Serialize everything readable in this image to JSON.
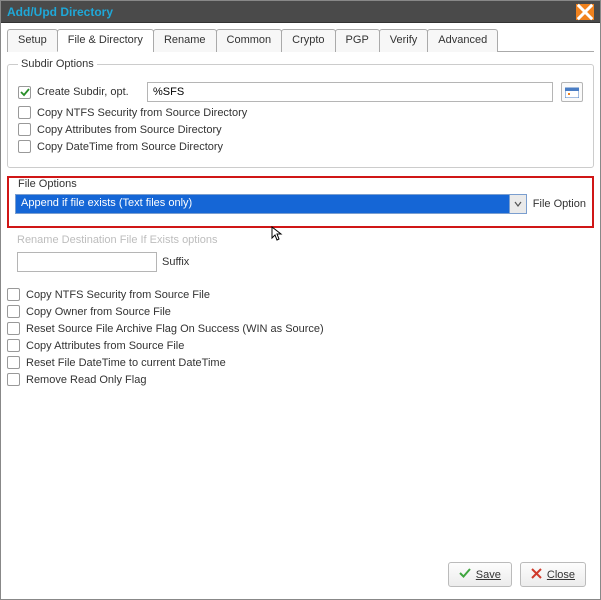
{
  "window": {
    "title": "Add/Upd Directory"
  },
  "tabs": [
    "Setup",
    "File & Directory",
    "Rename",
    "Common",
    "Crypto",
    "PGP",
    "Verify",
    "Advanced"
  ],
  "active_tab_index": 1,
  "subdir": {
    "legend": "Subdir Options",
    "create_label": "Create Subdir, opt.",
    "create_value": "%SFS",
    "copy_ntfs": "Copy NTFS Security from Source Directory",
    "copy_attrs": "Copy Attributes from Source Directory",
    "copy_datetime": "Copy DateTime from Source Directory"
  },
  "fileopts": {
    "legend": "File Options",
    "dropdown_value": "Append if file exists (Text files only)",
    "side_label": "File Option",
    "rename_group_title": "Rename Destination File If Exists options",
    "suffix_label": "Suffix",
    "copy_ntfs": "Copy NTFS Security from Source File",
    "copy_owner": "Copy Owner from Source File",
    "reset_archive": "Reset Source File Archive Flag On Success (WIN as Source)",
    "copy_attrs": "Copy Attributes from Source File",
    "reset_datetime": "Reset File DateTime to current DateTime",
    "remove_readonly": "Remove Read Only Flag"
  },
  "buttons": {
    "save": "Save",
    "close": "Close"
  }
}
